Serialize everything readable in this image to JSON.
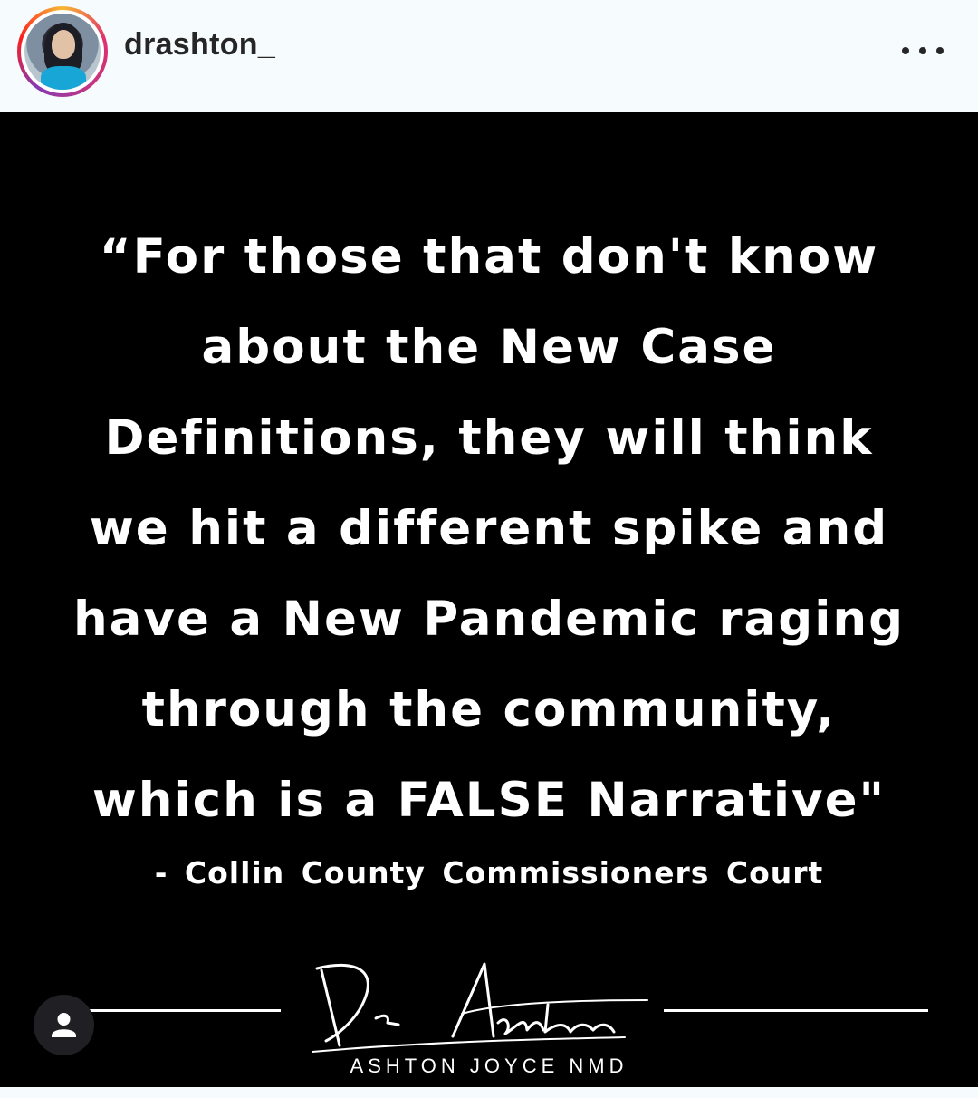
{
  "header": {
    "username": "drashton_"
  },
  "post": {
    "quote_lines": [
      "“For those that don't know",
      "about the New Case",
      "Definitions, they will think",
      "we hit a different spike and",
      "have a New Pandemic raging",
      "through the community,",
      "which is a FALSE Narrative\""
    ],
    "attribution": "- Collin County Commissioners Court",
    "signature_text": "Dr Ashton",
    "brand_line": "ASHTON JOYCE NMD"
  },
  "icons": {
    "more": "more-options-icon",
    "user_tag": "user-tag-icon"
  },
  "colors": {
    "post_background": "#000000",
    "text": "#ffffff",
    "header_background": "#f6fbfd"
  }
}
